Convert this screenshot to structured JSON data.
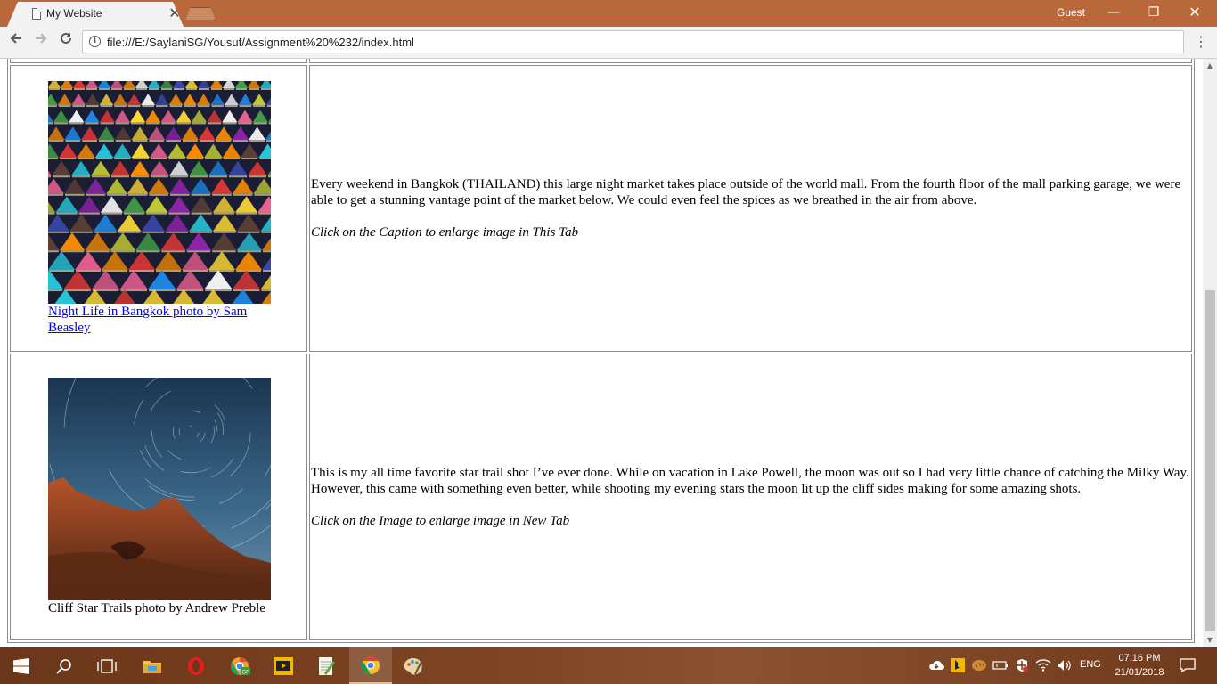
{
  "browser": {
    "tab_title": "My Website",
    "tab_close": "✕",
    "profile": "Guest",
    "url": "file:///E:/SaylaniSG/Yousuf/Assignment%20%232/index.html",
    "window_controls": {
      "minimize": "—",
      "maximize": "❐",
      "close": "✕"
    }
  },
  "content": {
    "rows": [
      {
        "photo_icon": "night-market-photo",
        "caption": "Night Life in Bangkok photo by Sam Beasley",
        "caption_is_link": true,
        "description": "Every weekend in Bangkok (THAILAND) this large night market takes place outside of the world mall. From the fourth floor of the mall parking garage, we were able to get a stunning vantage point of the market below. We could even feel the spices as we breathed in the air from above.",
        "hint": "Click on the Caption to enlarge image in This Tab"
      },
      {
        "photo_icon": "star-trails-photo",
        "caption": "Cliff Star Trails photo by Andrew Preble",
        "caption_is_link": false,
        "description": "This is my all time favorite star trail shot I’ve ever done. While on vacation in Lake Powell, the moon was out so I had very little chance of catching the Milky Way. However, this came with something even better, while shooting my evening stars the moon lit up the cliff sides making for some amazing shots.",
        "hint": "Click on the Image to enlarge image in New Tab"
      }
    ]
  },
  "taskbar": {
    "apps": [
      "windows-start",
      "search",
      "task-view",
      "file-explorer",
      "opera",
      "chrome-canary",
      "media-player",
      "notepad-plus",
      "chrome",
      "paint"
    ],
    "language": "ENG",
    "time": "07:16 PM",
    "date": "21/01/2018"
  },
  "colors": {
    "titlebar": "#b9683c",
    "taskbar": "#7e4422",
    "link": "#0000ee"
  }
}
